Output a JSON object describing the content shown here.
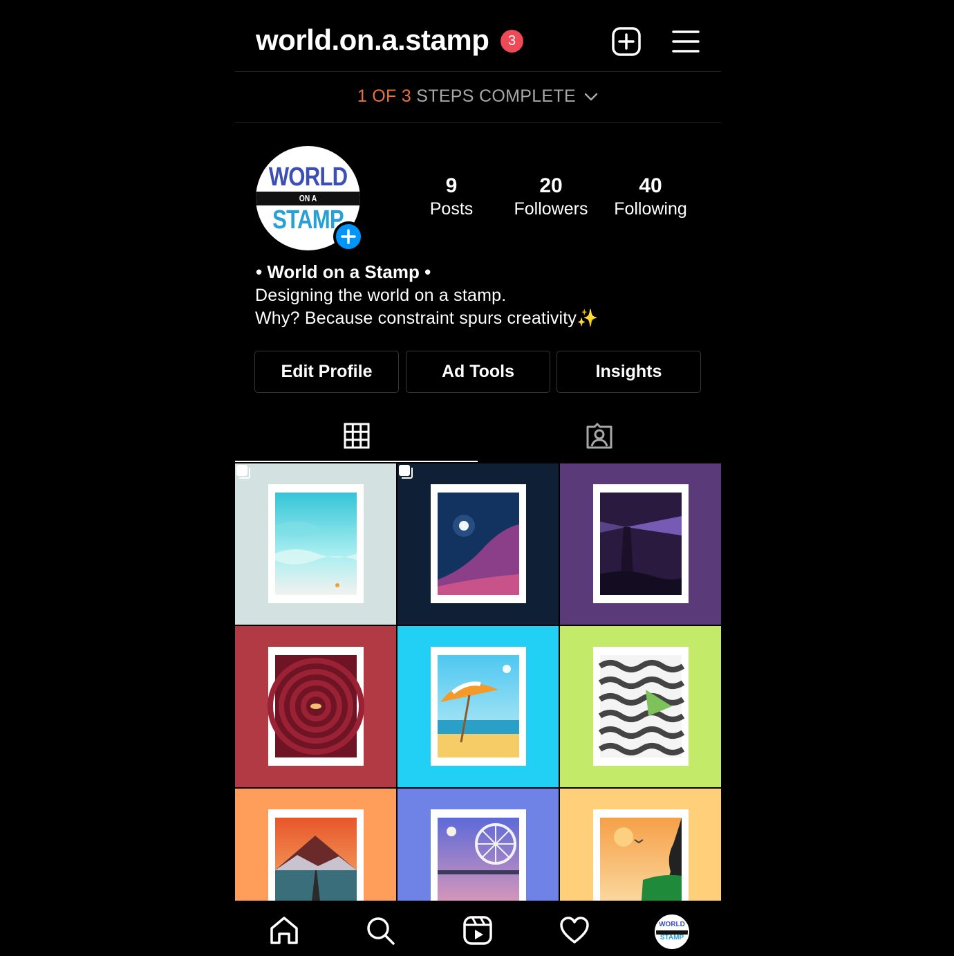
{
  "header": {
    "username": "world.on.a.stamp",
    "notification_count": "3",
    "new_post_icon": "plus-square-icon",
    "menu_icon": "hamburger-menu-icon"
  },
  "steps": {
    "count_text": "1 OF 3",
    "rest_text": "STEPS COMPLETE"
  },
  "profile": {
    "avatar_text": {
      "top": "WORLD",
      "middle": "ON A",
      "bottom": "STAMP"
    },
    "stats": [
      {
        "value": "9",
        "label": "Posts"
      },
      {
        "value": "20",
        "label": "Followers"
      },
      {
        "value": "40",
        "label": "Following"
      }
    ],
    "bio": {
      "name": "• World on a Stamp •",
      "line1": "Designing the world on a stamp.",
      "line2": "Why? Because constraint spurs creativity✨"
    }
  },
  "actions": {
    "edit_profile": "Edit Profile",
    "ad_tools": "Ad Tools",
    "insights": "Insights"
  },
  "tabs": {
    "active": "grid",
    "items": [
      "posts-grid",
      "tagged"
    ]
  },
  "posts": [
    {
      "name": "beach-waves-stamp",
      "bg": "#d3e2e0",
      "multi": true
    },
    {
      "name": "moon-desert-stamp",
      "bg": "#0f1f35",
      "multi": true
    },
    {
      "name": "lighthouse-stamp",
      "bg": "#5a3a78",
      "multi": false
    },
    {
      "name": "spiral-eye-stamp",
      "bg": "#b23a44",
      "multi": false
    },
    {
      "name": "beach-umbrella-stamp",
      "bg": "#22d0f5",
      "multi": false
    },
    {
      "name": "wave-boat-stamp",
      "bg": "#c4ea6a",
      "multi": false
    },
    {
      "name": "mountain-road-stamp",
      "bg": "#ff9e5a",
      "multi": false
    },
    {
      "name": "ferris-wheel-stamp",
      "bg": "#6f83e6",
      "multi": false
    },
    {
      "name": "sunset-silhouette-stamp",
      "bg": "#ffcf7a",
      "multi": false
    }
  ],
  "colors": {
    "accent_orange": "#e8743c",
    "badge_red": "#ed4956",
    "blue": "#0095f6"
  },
  "nav": {
    "items": [
      "home-icon",
      "search-icon",
      "reels-icon",
      "heart-icon",
      "profile-avatar"
    ]
  }
}
